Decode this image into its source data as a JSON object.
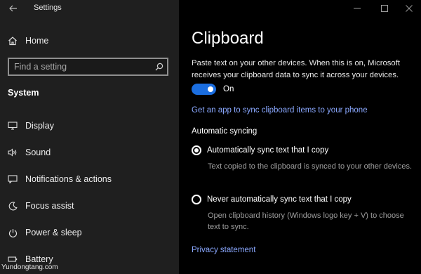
{
  "window": {
    "title": "Settings",
    "controls": {
      "minimize": "minimize-icon",
      "maximize": "maximize-icon",
      "close": "close-icon"
    }
  },
  "sidebar": {
    "home_label": "Home",
    "search_placeholder": "Find a setting",
    "section_title": "System",
    "items": [
      {
        "label": "Display",
        "icon": "display-icon"
      },
      {
        "label": "Sound",
        "icon": "sound-icon"
      },
      {
        "label": "Notifications & actions",
        "icon": "notifications-icon"
      },
      {
        "label": "Focus assist",
        "icon": "focus-assist-icon"
      },
      {
        "label": "Power & sleep",
        "icon": "power-icon"
      },
      {
        "label": "Battery",
        "icon": "battery-icon"
      }
    ]
  },
  "main": {
    "title": "Clipboard",
    "sync_description": "Paste text on your other devices. When this is on, Microsoft receives your clipboard data to sync it across your devices.",
    "toggle_state": "On",
    "get_app_link": "Get an app to sync clipboard items to your phone",
    "auto_sync_heading": "Automatic syncing",
    "option_auto_label": "Automatically sync text that I copy",
    "option_auto_help": "Text copied to the clipboard is synced to your other devices.",
    "option_never_label": "Never automatically sync text that I copy",
    "option_never_help": "Open clipboard history (Windows logo key + V) to choose text to sync.",
    "privacy_link": "Privacy statement"
  },
  "colors": {
    "accent": "#1b6ee0",
    "link": "#8aa8ff",
    "sidebar_bg": "#1f1f1f",
    "main_bg": "#000000"
  },
  "watermark": "Yundongtang.com"
}
